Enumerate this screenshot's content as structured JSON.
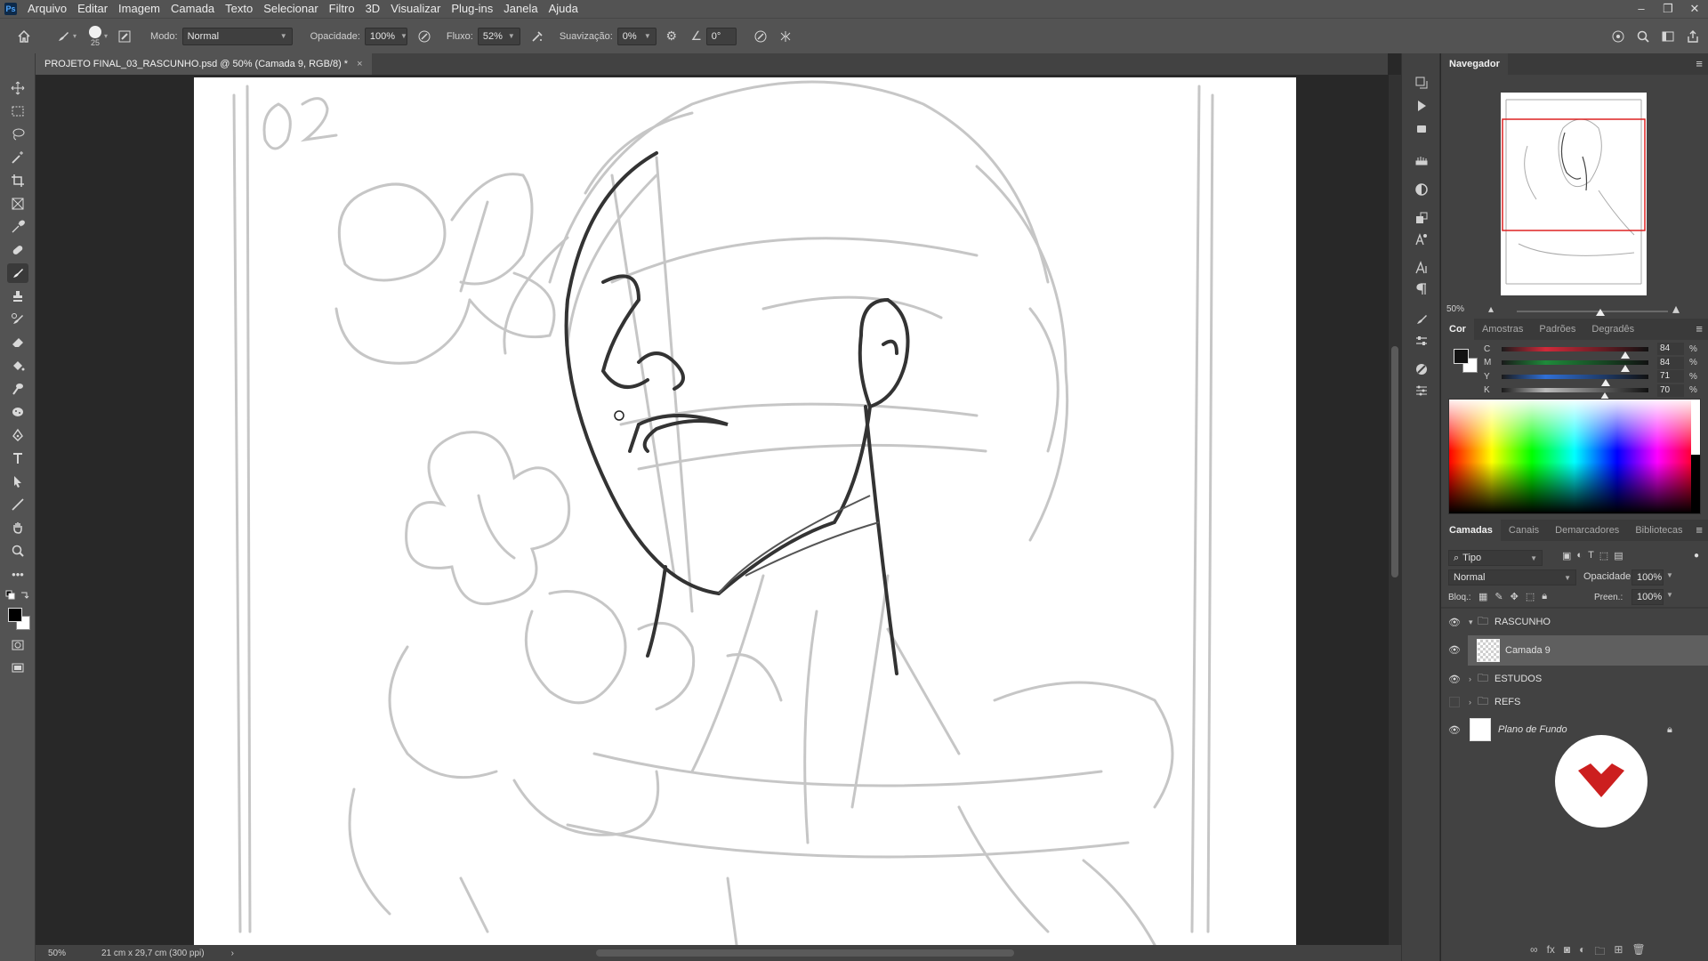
{
  "app": {
    "logo": "Ps"
  },
  "menu": [
    "Arquivo",
    "Editar",
    "Imagem",
    "Camada",
    "Texto",
    "Selecionar",
    "Filtro",
    "3D",
    "Visualizar",
    "Plug-ins",
    "Janela",
    "Ajuda"
  ],
  "window_controls": {
    "minimize": "–",
    "restore": "❐",
    "close": "✕"
  },
  "options": {
    "brush_size": "25",
    "mode_label": "Modo:",
    "mode_value": "Normal",
    "opacity_label": "Opacidade:",
    "opacity_value": "100%",
    "flow_label": "Fluxo:",
    "flow_value": "52%",
    "smoothing_label": "Suavização:",
    "smoothing_value": "0%",
    "angle_value": "0°"
  },
  "document": {
    "tab_title": "PROJETO FINAL_03_RASCUNHO.psd @ 50% (Camada 9, RGB/8) *",
    "close": "×"
  },
  "status": {
    "zoom": "50%",
    "doc_info": "21 cm x 29,7 cm (300 ppi)",
    "arrow": "›"
  },
  "navigator": {
    "title": "Navegador",
    "zoom": "50%",
    "zoom_level": 0.55
  },
  "color_panel": {
    "tabs": [
      "Cor",
      "Amostras",
      "Padrões",
      "Degradês"
    ],
    "sliders": [
      {
        "label": "C",
        "value": "84",
        "pct": "%",
        "pos": 0.84,
        "color": "#d12a3a"
      },
      {
        "label": "M",
        "value": "84",
        "pct": "%",
        "pos": 0.84,
        "color": "#1f8a3a"
      },
      {
        "label": "Y",
        "value": "71",
        "pct": "%",
        "pos": 0.71,
        "color": "#2f6fd6"
      },
      {
        "label": "K",
        "value": "70",
        "pct": "%",
        "pos": 0.7,
        "color": "#bbbbbb"
      }
    ]
  },
  "layers_panel": {
    "tabs": [
      "Camadas",
      "Canais",
      "Demarcadores",
      "Bibliotecas"
    ],
    "filter_value": "Tipo",
    "blend_mode": "Normal",
    "opacity_label": "Opacidade:",
    "opacity_value": "100%",
    "lock_label": "Bloq.:",
    "fill_label": "Preen.:",
    "fill_value": "100%",
    "layers": [
      {
        "name": "RASCUNHO",
        "visible": true
      },
      {
        "name": "Camada 9",
        "visible": true
      },
      {
        "name": "ESTUDOS",
        "visible": true
      },
      {
        "name": "REFS",
        "visible": false
      },
      {
        "name": "Plano de Fundo",
        "visible": true
      }
    ]
  },
  "colors": {
    "accent": "#cc1f1f",
    "panel": "#424242",
    "bar": "#535353",
    "canvas_bg": "#282828"
  }
}
